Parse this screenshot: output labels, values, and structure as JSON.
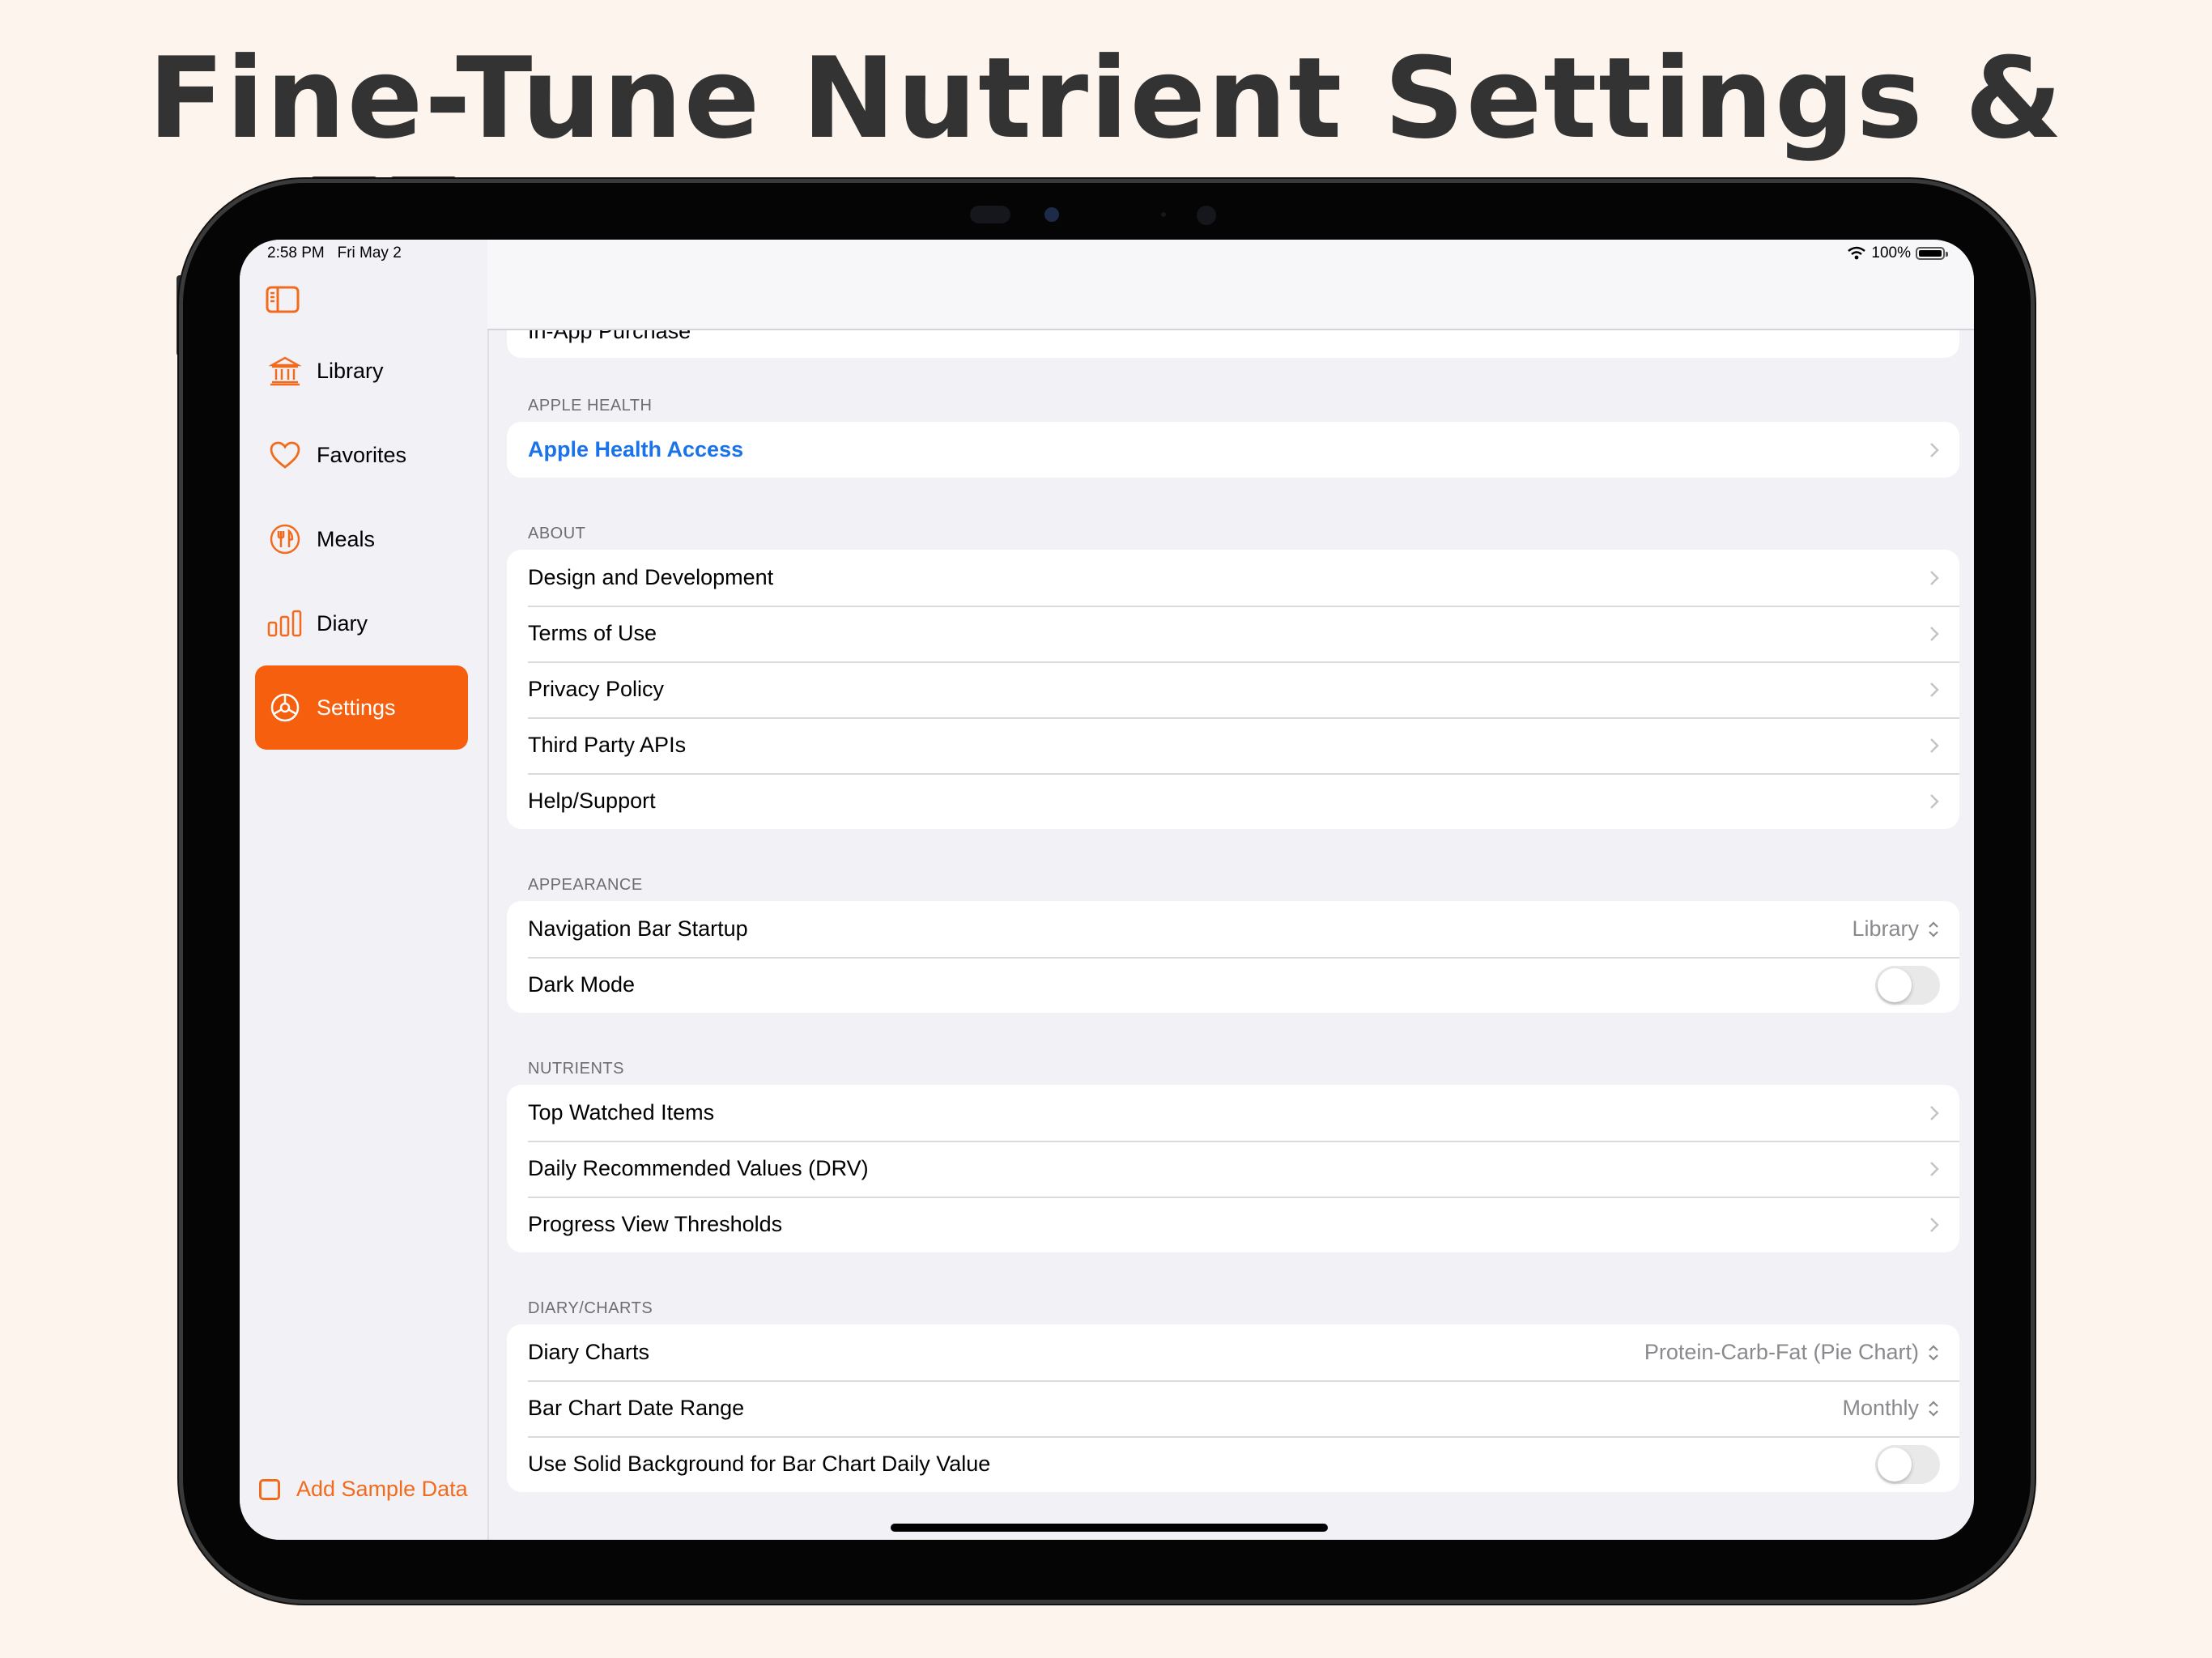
{
  "headline": "Fine-Tune Nutrient Settings & Look",
  "status_bar": {
    "time": "2:58 PM",
    "date": "Fri May 2",
    "battery": "100%"
  },
  "sidebar": {
    "items": [
      {
        "label": "Library",
        "icon": "library-icon"
      },
      {
        "label": "Favorites",
        "icon": "heart-icon"
      },
      {
        "label": "Meals",
        "icon": "fork-knife-icon"
      },
      {
        "label": "Diary",
        "icon": "bar-chart-icon"
      },
      {
        "label": "Settings",
        "icon": "gear-icon",
        "active": true
      }
    ],
    "add_sample": "Add Sample Data"
  },
  "partial_row_label": "In-App Purchase",
  "sections": {
    "apple_health": {
      "header": "APPLE HEALTH",
      "rows": [
        {
          "label": "Apple Health Access"
        }
      ]
    },
    "about": {
      "header": "ABOUT",
      "rows": [
        {
          "label": "Design and Development"
        },
        {
          "label": "Terms of Use"
        },
        {
          "label": "Privacy Policy"
        },
        {
          "label": "Third Party APIs"
        },
        {
          "label": "Help/Support"
        }
      ]
    },
    "appearance": {
      "header": "APPEARANCE",
      "rows": [
        {
          "label": "Navigation Bar Startup",
          "value": "Library"
        },
        {
          "label": "Dark Mode",
          "toggle": false
        }
      ]
    },
    "nutrients": {
      "header": "NUTRIENTS",
      "rows": [
        {
          "label": "Top Watched Items"
        },
        {
          "label": "Daily Recommended Values (DRV)"
        },
        {
          "label": "Progress View Thresholds"
        }
      ]
    },
    "diary_charts": {
      "header": "DIARY/CHARTS",
      "rows": [
        {
          "label": "Diary Charts",
          "value": "Protein-Carb-Fat (Pie Chart)"
        },
        {
          "label": "Bar Chart Date Range",
          "value": "Monthly"
        },
        {
          "label": "Use Solid Background for Bar Chart Daily Value",
          "toggle": false
        }
      ]
    }
  },
  "colors": {
    "accent": "#f55f0e",
    "link": "#1a73e8",
    "background": "#f2f1f6",
    "page": "#fdf4ee"
  }
}
